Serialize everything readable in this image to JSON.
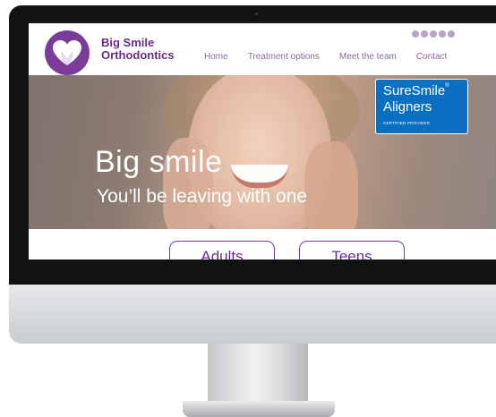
{
  "site": {
    "brand": {
      "name_line1": "Big Smile",
      "name_line2": "Orthodontics",
      "logo_icon": "heart-icon",
      "color": "#7a3c98"
    },
    "social_icons": [
      "facebook-icon",
      "twitter-icon",
      "instagram-icon",
      "youtube-icon",
      "email-icon"
    ],
    "nav": {
      "items": [
        {
          "label": "Home"
        },
        {
          "label": "Treatment options"
        },
        {
          "label": "Meet the team"
        },
        {
          "label": "Contact"
        }
      ]
    },
    "hero": {
      "title": "Big smile",
      "subtitle": "You’ll be leaving with one"
    },
    "badge": {
      "line1": "SureSmile",
      "reg_mark": "®",
      "line2": "Aligners",
      "sub": "CERTIFIED PROVIDER",
      "color": "#0a6fc0"
    },
    "cta": {
      "adults_label": "Adults",
      "teens_label": "Teens"
    }
  }
}
